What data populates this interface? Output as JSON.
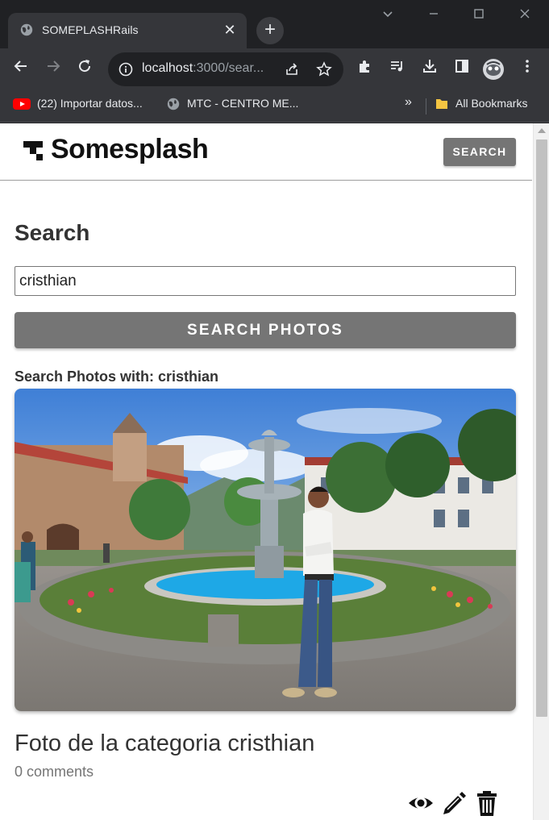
{
  "browser": {
    "tab_title": "SOMEPLASHRails",
    "url_host": "localhost",
    "url_path": ":3000/sear...",
    "bookmarks": [
      {
        "label": "(22) Importar datos..."
      },
      {
        "label": "MTC - CENTRO ME..."
      }
    ],
    "overflow_label": "»",
    "all_bookmarks_label": "All Bookmarks"
  },
  "nav": {
    "brand": "Somesplash",
    "search_label": "SEARCH"
  },
  "search": {
    "title": "Search",
    "query": "cristhian",
    "button_label": "SEARCH PHOTOS",
    "results_heading": "Search Photos with: cristhian"
  },
  "results": [
    {
      "title": "Foto de la categoria cristhian",
      "comments": "0 comments",
      "actions": [
        "eye-icon",
        "pencil-icon",
        "trash-icon"
      ]
    }
  ],
  "colors": {
    "button_gray": "#757575",
    "chrome_dark": "#202124",
    "chrome_toolbar": "#35363a"
  }
}
